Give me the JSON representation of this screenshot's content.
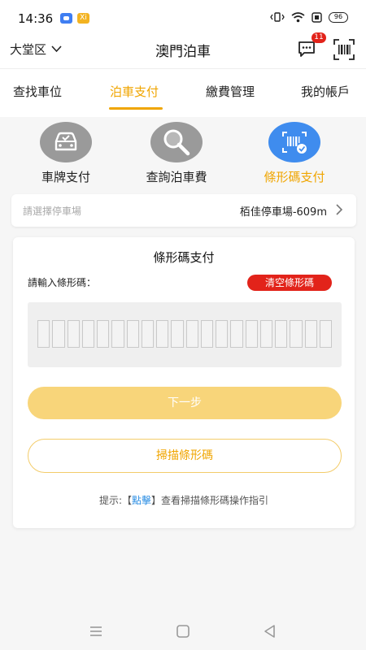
{
  "status_bar": {
    "time": "14:36",
    "orange_icon_text": "Xi",
    "battery": "96"
  },
  "header": {
    "district": "大堂区",
    "title": "澳門泊車",
    "message_badge": "11"
  },
  "tabs": [
    {
      "label": "查找車位",
      "active": false
    },
    {
      "label": "泊車支付",
      "active": true
    },
    {
      "label": "繳費管理",
      "active": false
    },
    {
      "label": "我的帳戶",
      "active": false
    }
  ],
  "payment_methods": [
    {
      "label": "車牌支付",
      "icon": "car-icon",
      "active": false
    },
    {
      "label": "查詢泊車費",
      "icon": "magnifier-icon",
      "active": false
    },
    {
      "label": "條形碼支付",
      "icon": "barcode-scan-icon",
      "active": true
    }
  ],
  "lot": {
    "placeholder": "請選擇停車場",
    "value": "栢佳停車場-609m"
  },
  "barcode_card": {
    "title": "條形碼支付",
    "input_label": "請輸入條形碼：",
    "clear_label": "清空條形碼",
    "next_label": "下一步",
    "scan_label": "掃描條形碼",
    "hint_prefix": "提示:【",
    "hint_link": "點擊",
    "hint_suffix": "】查看掃描條形碼操作指引"
  },
  "colors": {
    "accent": "#f0a500",
    "danger": "#e2231a",
    "link": "#2a8de3",
    "active_method": "#3f8cee",
    "inactive_method": "#9a9a9a"
  }
}
